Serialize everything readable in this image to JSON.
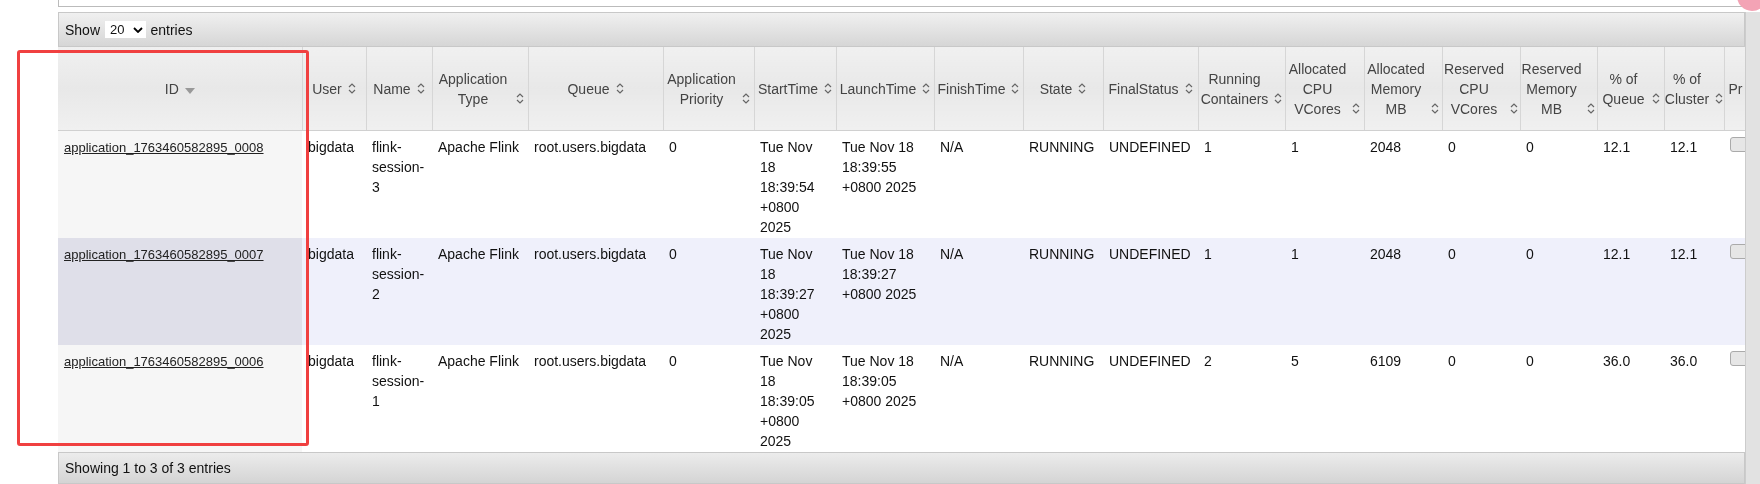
{
  "entries_control": {
    "before": "Show",
    "value": "20",
    "after": "entries"
  },
  "table": {
    "columns": [
      {
        "label": "ID",
        "sorted": true,
        "kind": "link"
      },
      {
        "label": "User",
        "sorted": false,
        "kind": "text"
      },
      {
        "label": "Name",
        "sorted": false,
        "kind": "text"
      },
      {
        "label": "Application Type",
        "sorted": false,
        "kind": "text"
      },
      {
        "label": "Queue",
        "sorted": false,
        "kind": "text"
      },
      {
        "label": "Application Priority",
        "sorted": false,
        "kind": "text"
      },
      {
        "label": "StartTime",
        "sorted": false,
        "kind": "text"
      },
      {
        "label": "LaunchTime",
        "sorted": false,
        "kind": "text"
      },
      {
        "label": "FinishTime",
        "sorted": false,
        "kind": "text"
      },
      {
        "label": "State",
        "sorted": false,
        "kind": "text"
      },
      {
        "label": "FinalStatus",
        "sorted": false,
        "kind": "text"
      },
      {
        "label": "Running Containers",
        "sorted": false,
        "kind": "text"
      },
      {
        "label": "Allocated CPU VCores",
        "sorted": false,
        "kind": "text"
      },
      {
        "label": "Allocated Memory MB",
        "sorted": false,
        "kind": "text"
      },
      {
        "label": "Reserved CPU VCores",
        "sorted": false,
        "kind": "text"
      },
      {
        "label": "Reserved Memory MB",
        "sorted": false,
        "kind": "text"
      },
      {
        "label": "% of Queue",
        "sorted": false,
        "kind": "text"
      },
      {
        "label": "% of Cluster",
        "sorted": false,
        "kind": "text"
      },
      {
        "label": "Pr",
        "kind": "progress"
      }
    ],
    "rows": [
      {
        "highlighted": false,
        "cells": [
          "application_1763460582895_0008",
          "bigdata",
          "flink-session-3",
          "Apache Flink",
          "root.users.bigdata",
          "0",
          "Tue Nov 18 18:39:54 +0800 2025",
          "Tue Nov 18 18:39:55 +0800 2025",
          "N/A",
          "RUNNING",
          "UNDEFINED",
          "1",
          "1",
          "2048",
          "0",
          "0",
          "12.1",
          "12.1"
        ]
      },
      {
        "highlighted": true,
        "cells": [
          "application_1763460582895_0007",
          "bigdata",
          "flink-session-2",
          "Apache Flink",
          "root.users.bigdata",
          "0",
          "Tue Nov 18 18:39:27 +0800 2025",
          "Tue Nov 18 18:39:27 +0800 2025",
          "N/A",
          "RUNNING",
          "UNDEFINED",
          "1",
          "1",
          "2048",
          "0",
          "0",
          "12.1",
          "12.1"
        ]
      },
      {
        "highlighted": false,
        "cells": [
          "application_1763460582895_0006",
          "bigdata",
          "flink-session-1",
          "Apache Flink",
          "root.users.bigdata",
          "0",
          "Tue Nov 18 18:39:05 +0800 2025",
          "Tue Nov 18 18:39:05 +0800 2025",
          "N/A",
          "RUNNING",
          "UNDEFINED",
          "2",
          "5",
          "6109",
          "0",
          "0",
          "36.0",
          "36.0"
        ]
      }
    ]
  },
  "footer": "Showing 1 to 3 of 3 entries"
}
